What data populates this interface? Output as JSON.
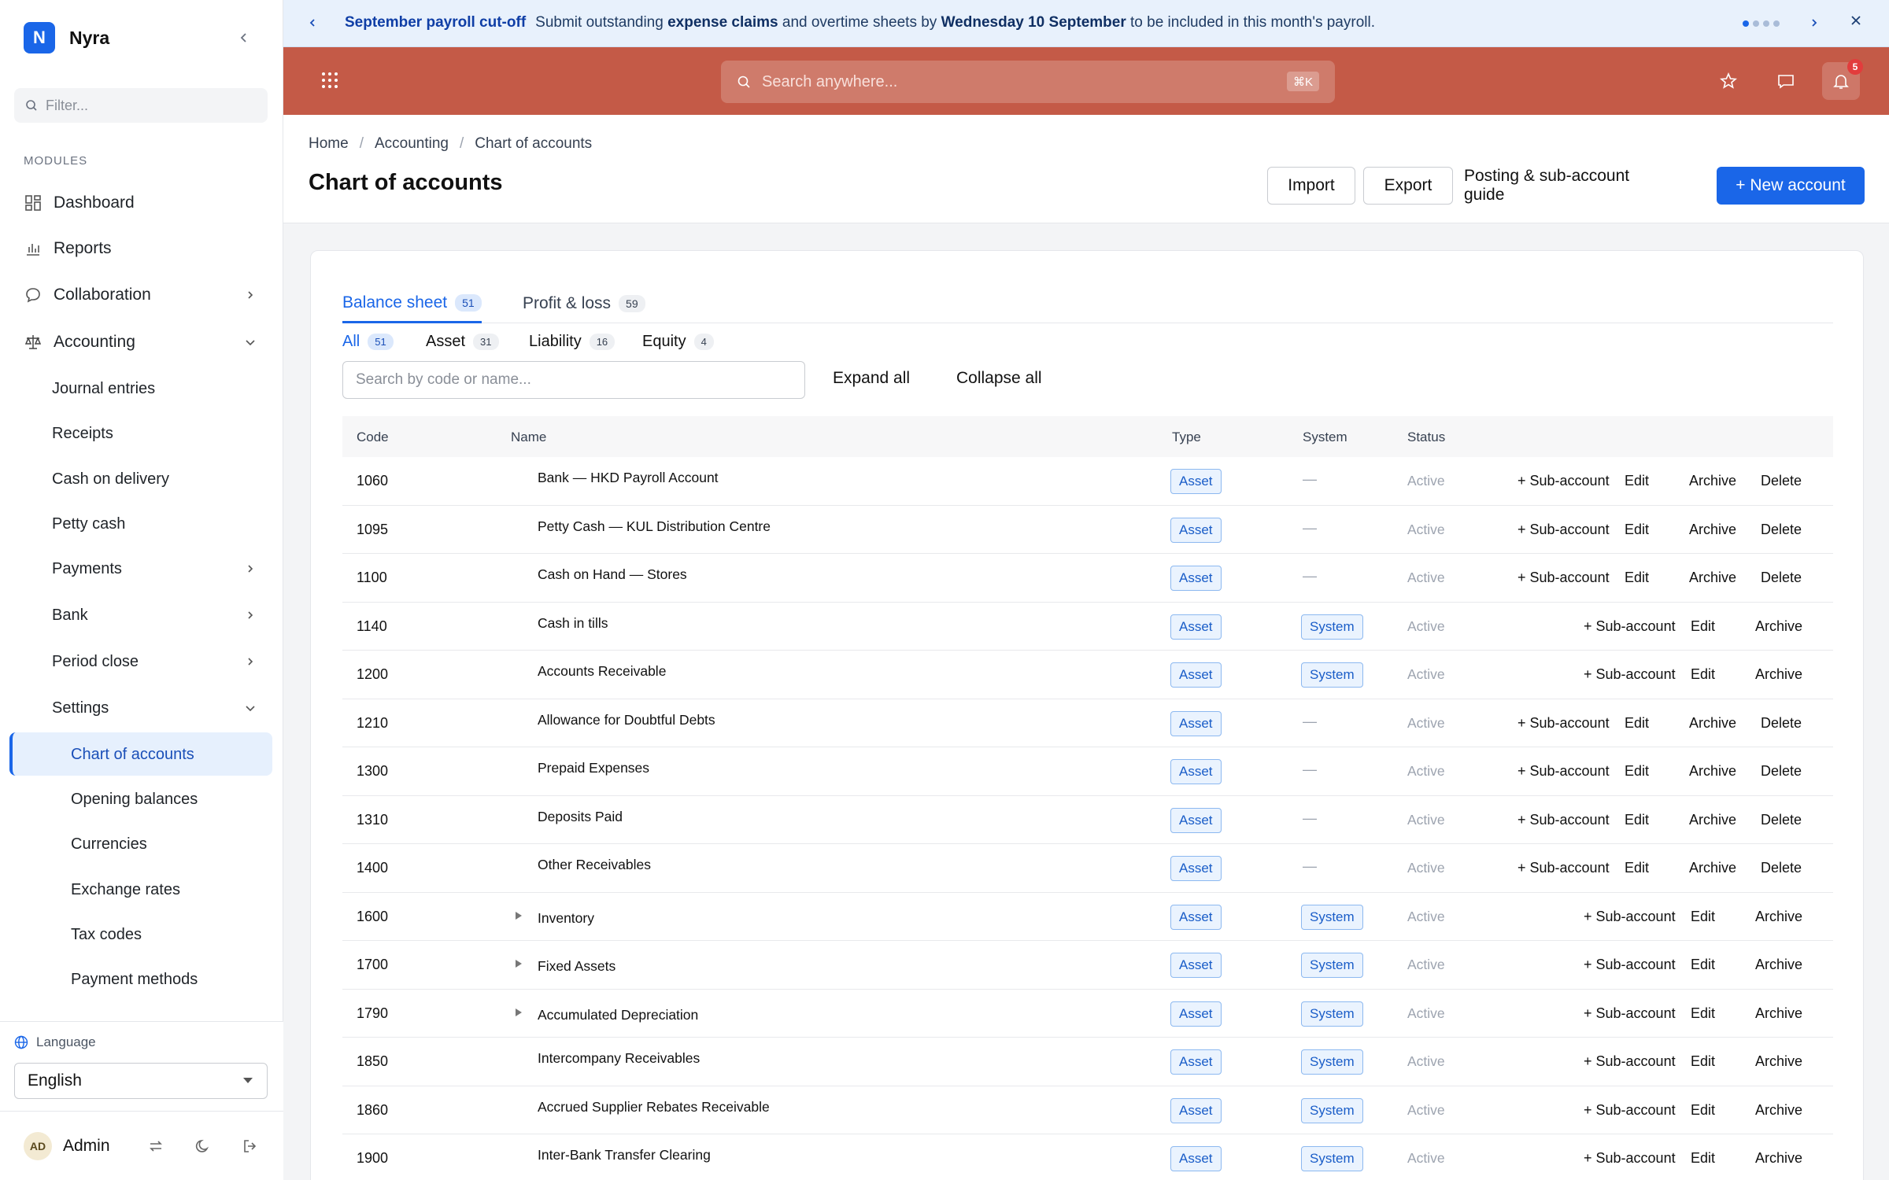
{
  "app": {
    "brand_letter": "N",
    "brand_name": "Nyra"
  },
  "sidebar": {
    "filter_placeholder": "Filter...",
    "modules_label": "MODULES",
    "top_items": [
      {
        "label": "Dashboard",
        "icon": "dashboard-icon"
      },
      {
        "label": "Reports",
        "icon": "reports-icon"
      },
      {
        "label": "Collaboration",
        "icon": "chat-icon",
        "chevron": "right"
      },
      {
        "label": "Accounting",
        "icon": "scale-icon",
        "chevron": "down"
      }
    ],
    "accounting_items": [
      {
        "label": "Journal entries"
      },
      {
        "label": "Receipts"
      },
      {
        "label": "Cash on delivery"
      },
      {
        "label": "Petty cash"
      },
      {
        "label": "Payments",
        "chevron": "right"
      },
      {
        "label": "Bank",
        "chevron": "right"
      },
      {
        "label": "Period close",
        "chevron": "right"
      },
      {
        "label": "Settings",
        "chevron": "down"
      }
    ],
    "settings_items": [
      {
        "label": "Chart of accounts",
        "active": true
      },
      {
        "label": "Opening balances"
      },
      {
        "label": "Currencies"
      },
      {
        "label": "Exchange rates"
      },
      {
        "label": "Tax codes"
      },
      {
        "label": "Payment methods"
      }
    ],
    "language_label": "Language",
    "language_value": "English",
    "user_initials": "AD",
    "user_name": "Admin"
  },
  "banner": {
    "title": "September payroll cut-off",
    "text_1": "Submit outstanding ",
    "bold_1": "expense claims",
    "text_2": " and overtime sheets by ",
    "bold_2": "Wednesday 10 September",
    "text_3": " to be included in this month's payroll.",
    "colors": {
      "background": "#e8f1fc",
      "title": "#0f3ea6"
    }
  },
  "topbar": {
    "search_placeholder": "Search anywhere...",
    "shortcut": "⌘K",
    "notification_count": "5",
    "color": "#c45a47"
  },
  "page": {
    "breadcrumb": [
      "Home",
      "Accounting",
      "Chart of accounts"
    ],
    "title": "Chart of accounts",
    "buttons": {
      "import": "Import",
      "export": "Export",
      "guide": "Posting & sub-account guide",
      "new": "+ New account"
    }
  },
  "tabs": [
    {
      "label": "Balance sheet",
      "count": "51",
      "active": true
    },
    {
      "label": "Profit & loss",
      "count": "59"
    }
  ],
  "subtabs": [
    {
      "label": "All",
      "count": "51",
      "active": true
    },
    {
      "label": "Asset",
      "count": "31"
    },
    {
      "label": "Liability",
      "count": "16"
    },
    {
      "label": "Equity",
      "count": "4"
    }
  ],
  "table": {
    "search_placeholder": "Search by code or name...",
    "expand_all": "Expand all",
    "collapse_all": "Collapse all",
    "headers": {
      "code": "Code",
      "name": "Name",
      "type": "Type",
      "system": "System",
      "status": "Status"
    },
    "actions": {
      "sub": "+ Sub-account",
      "edit": "Edit",
      "archive": "Archive",
      "delete": "Delete"
    },
    "dash": "—",
    "rows": [
      {
        "code": "1060",
        "name": "Bank — HKD Payroll Account",
        "type": "Asset",
        "system": "",
        "status": "Active",
        "expandable": false
      },
      {
        "code": "1095",
        "name": "Petty Cash — KUL Distribution Centre",
        "type": "Asset",
        "system": "",
        "status": "Active",
        "expandable": false
      },
      {
        "code": "1100",
        "name": "Cash on Hand — Stores",
        "type": "Asset",
        "system": "",
        "status": "Active",
        "expandable": false
      },
      {
        "code": "1140",
        "name": "Cash in tills",
        "type": "Asset",
        "system": "System",
        "status": "Active",
        "expandable": false
      },
      {
        "code": "1200",
        "name": "Accounts Receivable",
        "type": "Asset",
        "system": "System",
        "status": "Active",
        "expandable": false
      },
      {
        "code": "1210",
        "name": "Allowance for Doubtful Debts",
        "type": "Asset",
        "system": "",
        "status": "Active",
        "expandable": false
      },
      {
        "code": "1300",
        "name": "Prepaid Expenses",
        "type": "Asset",
        "system": "",
        "status": "Active",
        "expandable": false
      },
      {
        "code": "1310",
        "name": "Deposits Paid",
        "type": "Asset",
        "system": "",
        "status": "Active",
        "expandable": false
      },
      {
        "code": "1400",
        "name": "Other Receivables",
        "type": "Asset",
        "system": "",
        "status": "Active",
        "expandable": false
      },
      {
        "code": "1600",
        "name": "Inventory",
        "type": "Asset",
        "system": "System",
        "status": "Active",
        "expandable": true
      },
      {
        "code": "1700",
        "name": "Fixed Assets",
        "type": "Asset",
        "system": "System",
        "status": "Active",
        "expandable": true
      },
      {
        "code": "1790",
        "name": "Accumulated Depreciation",
        "type": "Asset",
        "system": "System",
        "status": "Active",
        "expandable": true
      },
      {
        "code": "1850",
        "name": "Intercompany Receivables",
        "type": "Asset",
        "system": "System",
        "status": "Active",
        "expandable": false
      },
      {
        "code": "1860",
        "name": "Accrued Supplier Rebates Receivable",
        "type": "Asset",
        "system": "System",
        "status": "Active",
        "expandable": false
      },
      {
        "code": "1900",
        "name": "Inter-Bank Transfer Clearing",
        "type": "Asset",
        "system": "System",
        "status": "Active",
        "expandable": false
      }
    ]
  }
}
